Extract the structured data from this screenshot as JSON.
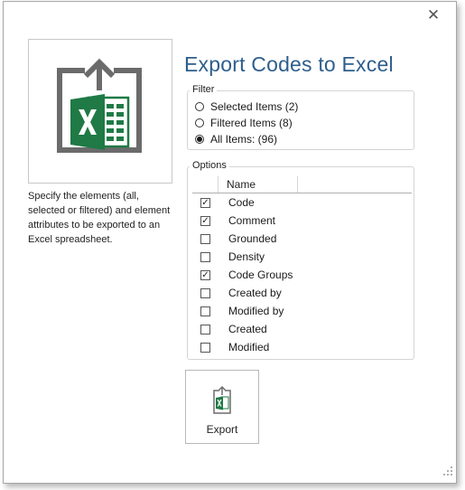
{
  "window": {
    "close_glyph": "✕"
  },
  "header": {
    "title": "Export Codes to Excel"
  },
  "description": "Specify the elements (all, selected or filtered) and element attributes to be exported to an Excel spreadsheet.",
  "filter": {
    "label": "Filter",
    "options": [
      {
        "label": "Selected Items (2)",
        "selected": false
      },
      {
        "label": "Filtered Items (8)",
        "selected": false
      },
      {
        "label": "All Items: (96)",
        "selected": true
      }
    ]
  },
  "options": {
    "label": "Options",
    "column_header": "Name",
    "items": [
      {
        "label": "Code",
        "checked": true
      },
      {
        "label": "Comment",
        "checked": true
      },
      {
        "label": "Grounded",
        "checked": false
      },
      {
        "label": "Density",
        "checked": false
      },
      {
        "label": "Code Groups",
        "checked": true
      },
      {
        "label": "Created by",
        "checked": false
      },
      {
        "label": "Modified by",
        "checked": false
      },
      {
        "label": "Created",
        "checked": false
      },
      {
        "label": "Modified",
        "checked": false
      }
    ]
  },
  "export_button": {
    "label": "Export"
  },
  "icons": {
    "large_icon": "excel-export-icon",
    "export_icon": "excel-small-icon",
    "resize": "resize-grip-icon"
  },
  "colors": {
    "title_blue": "#2e5e8c",
    "excel_green": "#1f7a45",
    "icon_gray": "#6b6b6b"
  }
}
